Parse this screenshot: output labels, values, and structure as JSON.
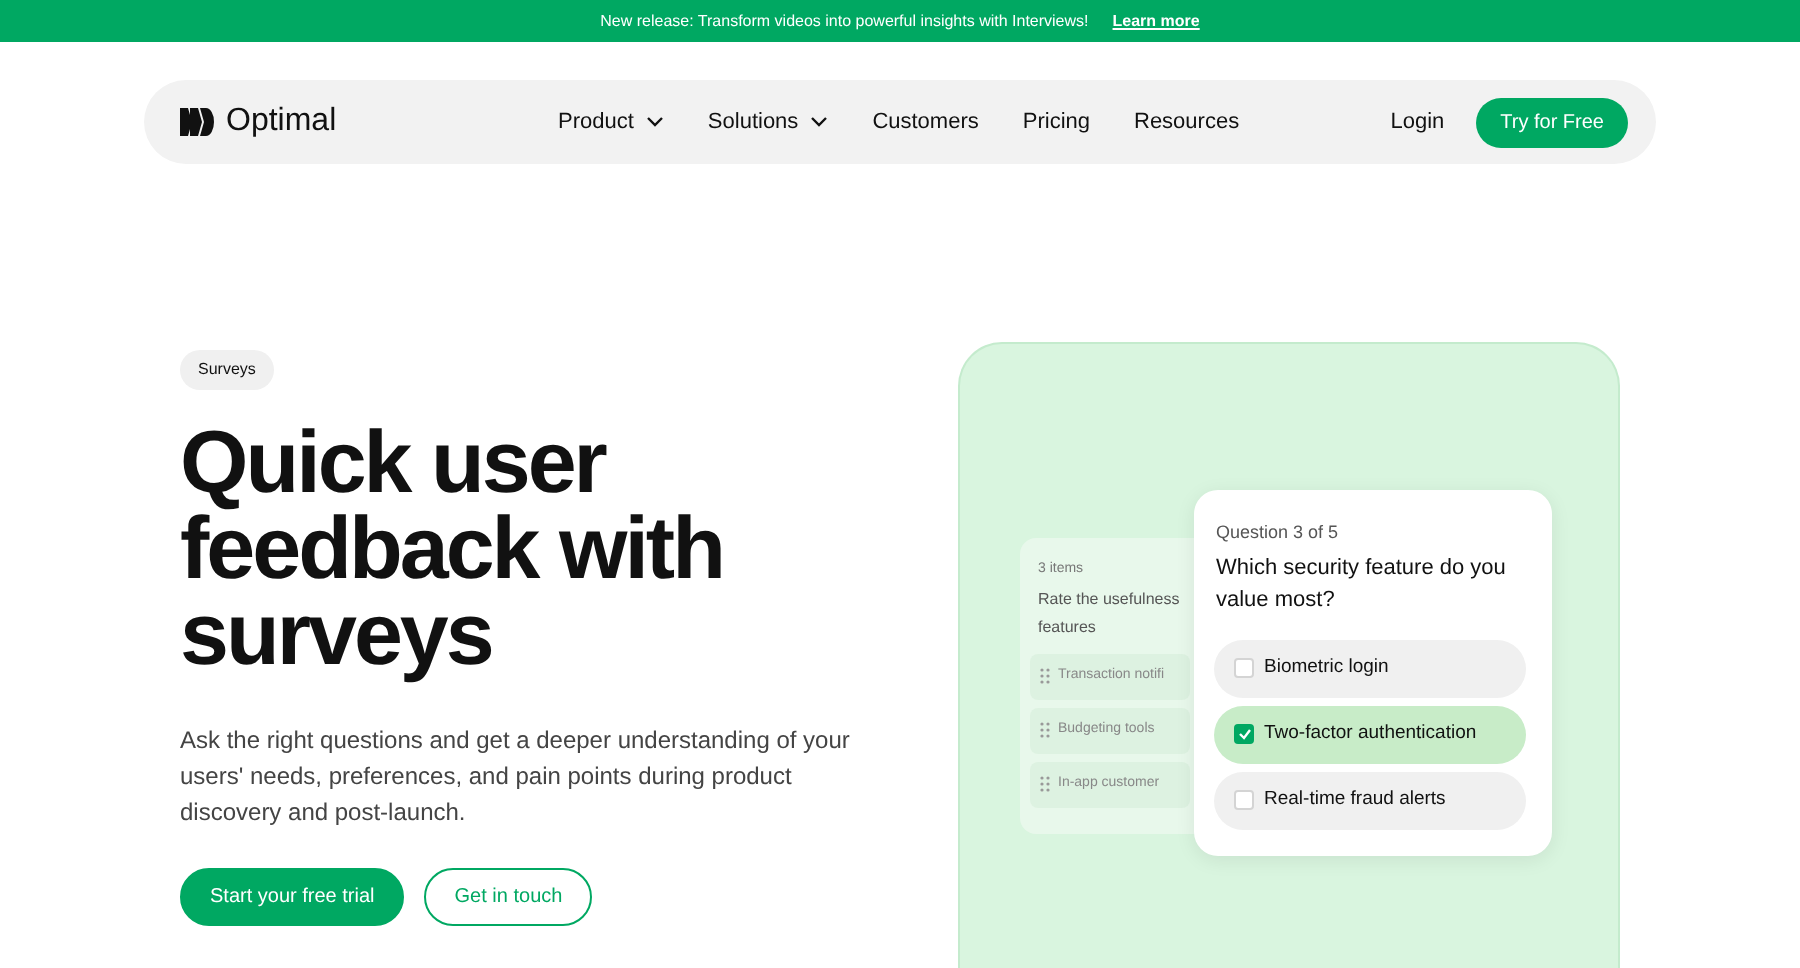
{
  "banner": {
    "text": "New release: Transform videos into powerful insights with Interviews!",
    "link": "Learn more"
  },
  "nav": {
    "logo": "Optimal",
    "items": [
      {
        "label": "Product",
        "dropdown": true
      },
      {
        "label": "Solutions",
        "dropdown": true
      },
      {
        "label": "Customers",
        "dropdown": false
      },
      {
        "label": "Pricing",
        "dropdown": false
      },
      {
        "label": "Resources",
        "dropdown": false
      }
    ],
    "login": "Login",
    "cta": "Try for Free"
  },
  "hero": {
    "badge": "Surveys",
    "heading_lines": [
      "Quick user",
      "feedback with",
      "surveys"
    ],
    "description": "Ask the right questions and get a deeper understanding of your users' needs, preferences, and pain points during product discovery and post-launch.",
    "buttons": [
      {
        "label": "Start your free trial",
        "kind": "primary"
      },
      {
        "label": "Get in touch",
        "kind": "outline"
      }
    ]
  },
  "back_card": {
    "count": "3 items",
    "title_lines": [
      "Rate the usefulness",
      "features"
    ],
    "items": [
      "Transaction notifi",
      "Budgeting tools",
      "In-app customer"
    ]
  },
  "question_card": {
    "progress": "Question 3 of 5",
    "question": "Which security feature do you value most?",
    "options": [
      {
        "label": "Biometric login",
        "checked": false
      },
      {
        "label": "Two-factor authentication",
        "checked": true
      },
      {
        "label": "Real-time fraud alerts",
        "checked": false
      }
    ]
  }
}
